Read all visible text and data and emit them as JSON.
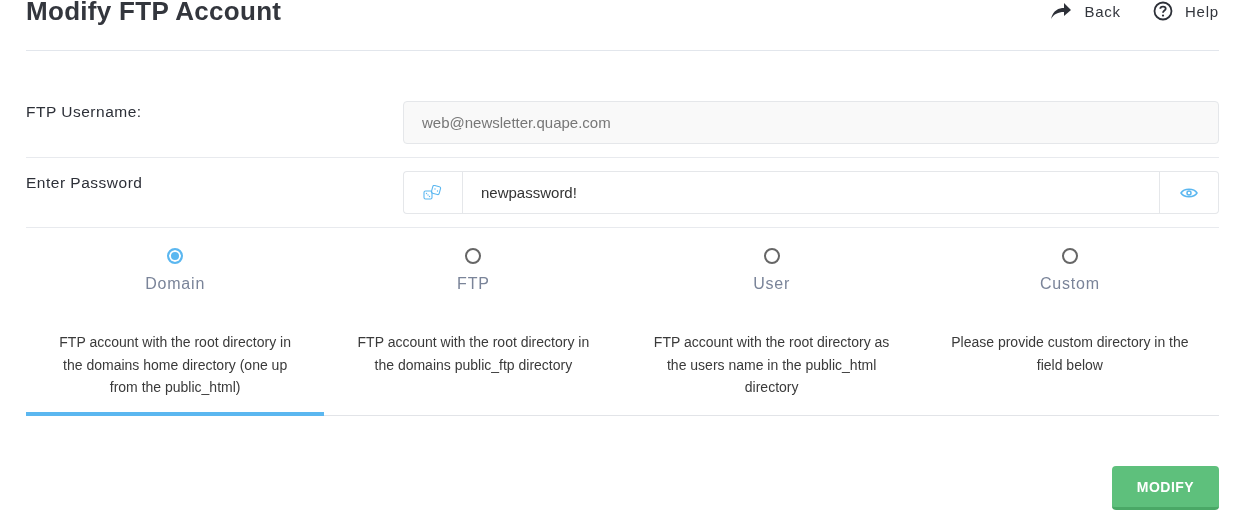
{
  "title": "Modify FTP Account",
  "header_links": [
    {
      "kind": "back",
      "label": "Back"
    },
    {
      "kind": "help",
      "label": "Help"
    }
  ],
  "username": {
    "label": "FTP Username:",
    "value": "web@newsletter.quape.com",
    "disabled": true
  },
  "password": {
    "label": "Enter Password",
    "value": "newpassword!"
  },
  "directory_options": [
    {
      "label": "Domain",
      "selected": true,
      "description": "FTP account with the root directory in the domains home directory (one up from the public_html)"
    },
    {
      "label": "FTP",
      "selected": false,
      "description": "FTP account with the root directory in the domains public_ftp directory"
    },
    {
      "label": "User",
      "selected": false,
      "description": "FTP account with the root directory as the users name in the public_html directory"
    },
    {
      "label": "Custom",
      "selected": false,
      "description": "Please provide custom directory in the field below"
    }
  ],
  "submit": {
    "label": "MODIFY"
  }
}
